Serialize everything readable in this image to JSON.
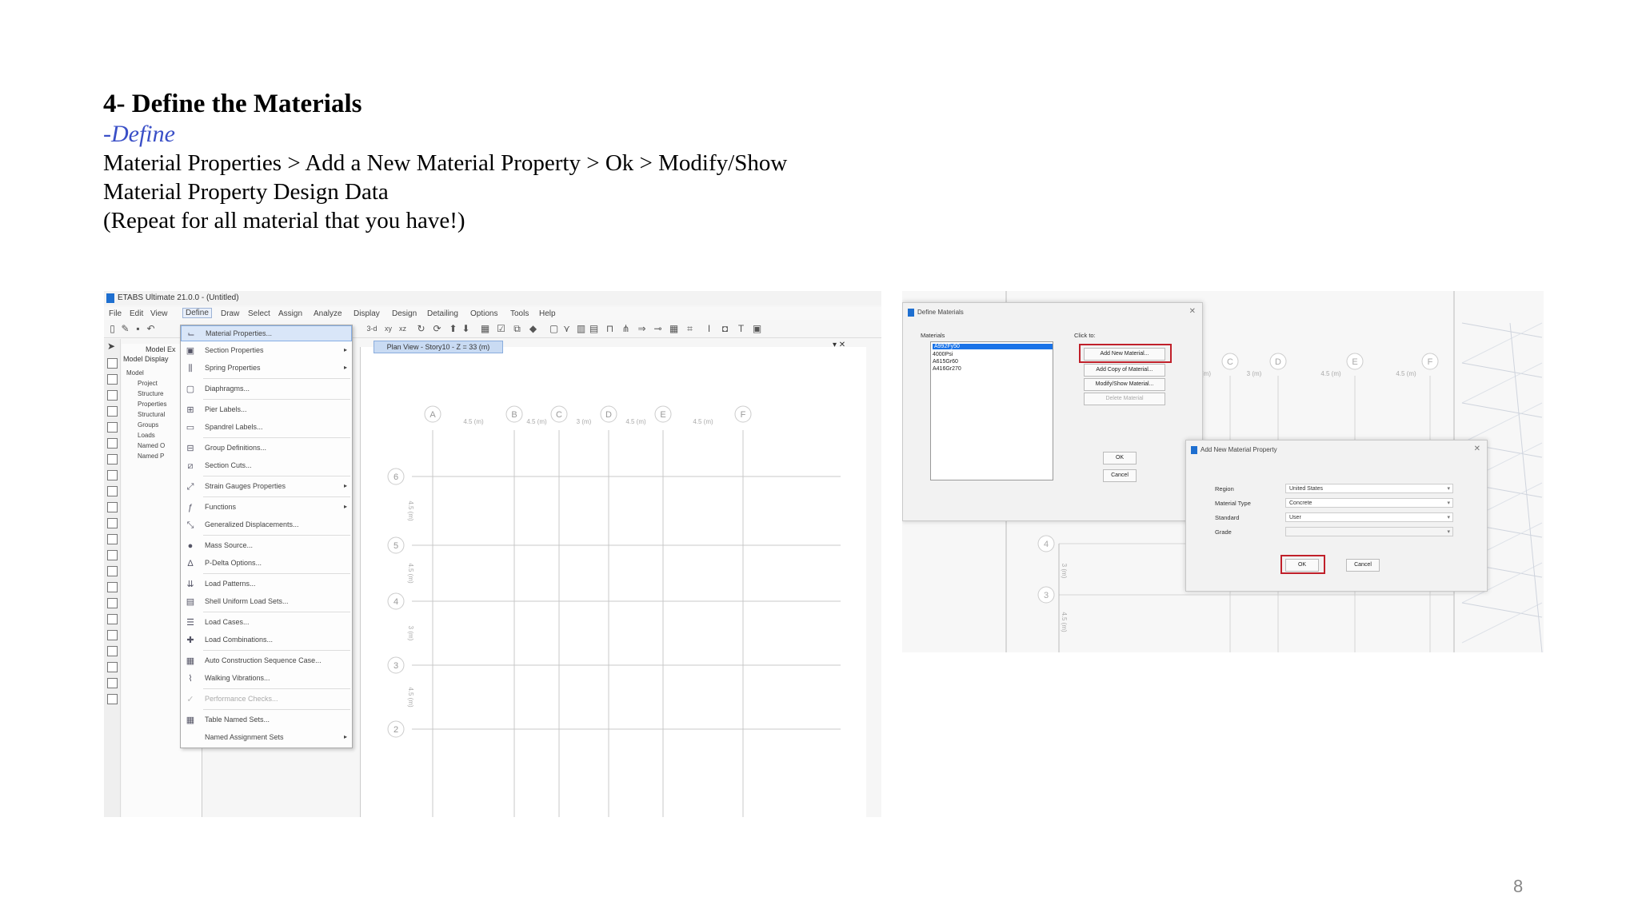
{
  "heading": "4- Define the Materials",
  "subheading": "-Define",
  "paragraph_lines": [
    "Material Properties > Add a New Material Property > Ok > Modify/Show",
    "Material Property Design Data",
    "(Repeat for all material that you have!)"
  ],
  "page_number": "8",
  "etabs": {
    "title": "ETABS Ultimate 21.0.0 - (Untitled)",
    "menu": [
      "File",
      "Edit",
      "View",
      "Define",
      "Draw",
      "Select",
      "Assign",
      "Analyze",
      "Display",
      "Design",
      "Detailing",
      "Options",
      "Tools",
      "Help"
    ],
    "active_menu": "Define",
    "toolbar_labels": [
      "3-d",
      "xy",
      "xz"
    ],
    "explorer": {
      "header": "Model Ex",
      "tabs": "Model  Display",
      "tree": [
        "Model",
        "Project",
        "Structure",
        "Properties",
        "Structural",
        "Groups",
        "Loads",
        "Named O",
        "Named P"
      ]
    },
    "define_menu": [
      {
        "label": "Material Properties...",
        "submenu": false,
        "icon": "material-icon"
      },
      {
        "label": "Section Properties",
        "submenu": true,
        "icon": "section-icon"
      },
      {
        "label": "Spring Properties",
        "submenu": true,
        "icon": "spring-icon"
      },
      {
        "label": "Diaphragms...",
        "submenu": false,
        "icon": "diaphragm-icon"
      },
      {
        "label": "Pier Labels...",
        "submenu": false,
        "icon": "pier-icon"
      },
      {
        "label": "Spandrel Labels...",
        "submenu": false,
        "icon": "spandrel-icon"
      },
      {
        "label": "Group Definitions...",
        "submenu": false,
        "icon": "group-icon"
      },
      {
        "label": "Section Cuts...",
        "submenu": false,
        "icon": "section-cut-icon"
      },
      {
        "label": "Strain Gauges Properties",
        "submenu": true,
        "icon": "strain-gauge-icon"
      },
      {
        "label": "Functions",
        "submenu": true,
        "icon": "function-icon"
      },
      {
        "label": "Generalized Displacements...",
        "submenu": false,
        "icon": "displacement-icon"
      },
      {
        "label": "Mass Source...",
        "submenu": false,
        "icon": "mass-icon"
      },
      {
        "label": "P-Delta Options...",
        "submenu": false,
        "icon": "pdelta-icon"
      },
      {
        "label": "Load Patterns...",
        "submenu": false,
        "icon": "load-pattern-icon"
      },
      {
        "label": "Shell Uniform Load Sets...",
        "submenu": false,
        "icon": "shell-load-icon"
      },
      {
        "label": "Load Cases...",
        "submenu": false,
        "icon": "load-case-icon"
      },
      {
        "label": "Load Combinations...",
        "submenu": false,
        "icon": "load-combo-icon"
      },
      {
        "label": "Auto Construction Sequence Case...",
        "submenu": false,
        "icon": "construction-icon"
      },
      {
        "label": "Walking Vibrations...",
        "submenu": false,
        "icon": "walking-icon"
      },
      {
        "label": "Performance Checks...",
        "submenu": false,
        "icon": "performance-icon"
      },
      {
        "label": "Table Named Sets...",
        "submenu": false,
        "icon": "table-icon"
      },
      {
        "label": "Named Assignment Sets",
        "submenu": true,
        "icon": "assignment-icon"
      }
    ],
    "plan_tab": "Plan View - Story10 - Z = 33 (m)",
    "grid_columns": [
      "A",
      "B",
      "C",
      "D",
      "E",
      "F"
    ],
    "grid_rows": [
      "6",
      "5",
      "4",
      "3",
      "2"
    ],
    "column_spacings": [
      "4.5 (m)",
      "4.5 (m)",
      "3 (m)",
      "4.5 (m)",
      "4.5 (m)"
    ],
    "row_spacings": [
      "4.5 (m)",
      "4.5 (m)",
      "3 (m)",
      "4.5 (m)"
    ]
  },
  "define_materials_dialog": {
    "title": "Define Materials",
    "materials_label": "Materials",
    "click_to_label": "Click to:",
    "materials": [
      "4000Psi",
      "A615Gr60",
      "A416Gr270"
    ],
    "selected_material": "A992Fy50",
    "buttons": [
      "Add New Material...",
      "Add Copy of Material...",
      "Modify/Show Material...",
      "Delete Material"
    ],
    "ok": "OK",
    "cancel": "Cancel"
  },
  "add_material_dialog": {
    "title": "Add New Material Property",
    "fields": [
      {
        "label": "Region",
        "value": "United States"
      },
      {
        "label": "Material Type",
        "value": "Concrete"
      },
      {
        "label": "Standard",
        "value": "User"
      },
      {
        "label": "Grade",
        "value": ""
      }
    ],
    "ok": "OK",
    "cancel": "Cancel"
  },
  "background_plan": {
    "columns": [
      "C",
      "D",
      "E",
      "F"
    ],
    "rows": [
      "4",
      "3"
    ],
    "spacings": [
      "(m)",
      "3 (m)",
      "4.5 (m)",
      "4.5 (m)"
    ],
    "row_spacings": [
      "3 (m)",
      "4.5 (m)"
    ]
  }
}
